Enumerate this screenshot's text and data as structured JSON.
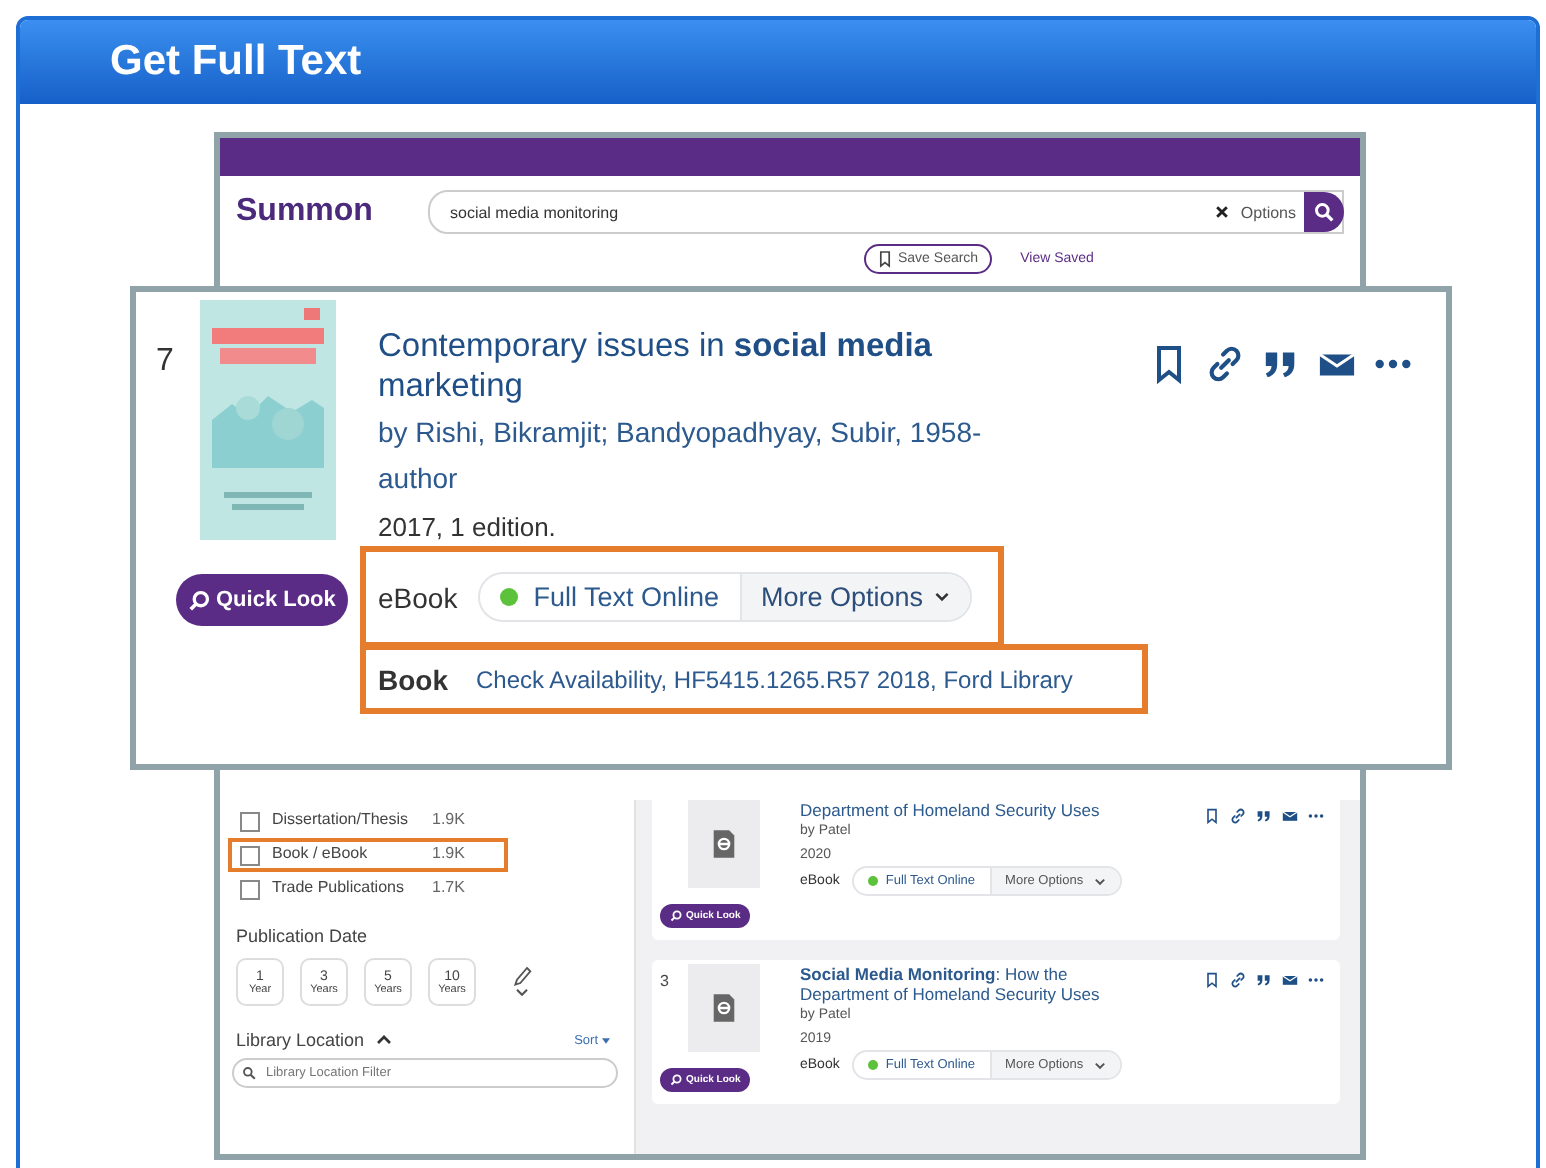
{
  "slide": {
    "title": "Get Full Text"
  },
  "search_page": {
    "logo": "Summon",
    "search": {
      "value": "social media monitoring",
      "options": "Options"
    },
    "save_search": "Save Search",
    "view_saved": "View Saved"
  },
  "sidebar": {
    "content_types": [
      {
        "label": "Dissertation/Thesis",
        "count": "1.9K",
        "checked": false,
        "highlighted": false
      },
      {
        "label": "Book / eBook",
        "count": "1.9K",
        "checked": false,
        "highlighted": true
      },
      {
        "label": "Trade Publications",
        "count": "1.7K",
        "checked": false,
        "highlighted": false
      }
    ],
    "publication_date": {
      "title": "Publication Date",
      "ranges": [
        {
          "number": "1",
          "unit": "Year"
        },
        {
          "number": "3",
          "unit": "Years"
        },
        {
          "number": "5",
          "unit": "Years"
        },
        {
          "number": "10",
          "unit": "Years"
        }
      ]
    },
    "library_location": {
      "title": "Library Location",
      "expanded": true,
      "sort": "Sort",
      "filter": {
        "placeholder": "Library Location Filter"
      }
    }
  },
  "results": [
    {
      "title": "Department of Homeland Security Uses",
      "author": "by Patel",
      "year": "2020",
      "format": "eBook",
      "access": "Full Text Online",
      "more": "More Options",
      "quick_look": "Quick Look"
    },
    {
      "number": "3",
      "title": "**Social Media Monitoring**: How the Department of Homeland Security Uses",
      "author": "by Patel",
      "year": "2019",
      "format": "eBook",
      "access": "Full Text Online",
      "more": "More Options",
      "quick_look": "Quick Look"
    }
  ],
  "focus_card": {
    "number": "7",
    "title": "Contemporary issues in **social media** marketing",
    "authors": "by Rishi, Bikramjit; Bandyopadhyay, Subir, 1958- author",
    "edition": "2017, 1 edition.",
    "quick_look": "Quick Look",
    "formats": [
      {
        "kind": "online",
        "label": "eBook",
        "access": "Full Text Online",
        "more": "More Options",
        "highlighted": true
      },
      {
        "kind": "holding",
        "label": "Book",
        "availability": "Check Availability, HF5415.1265.R57 2018, Ford Library",
        "highlighted": true
      }
    ]
  }
}
